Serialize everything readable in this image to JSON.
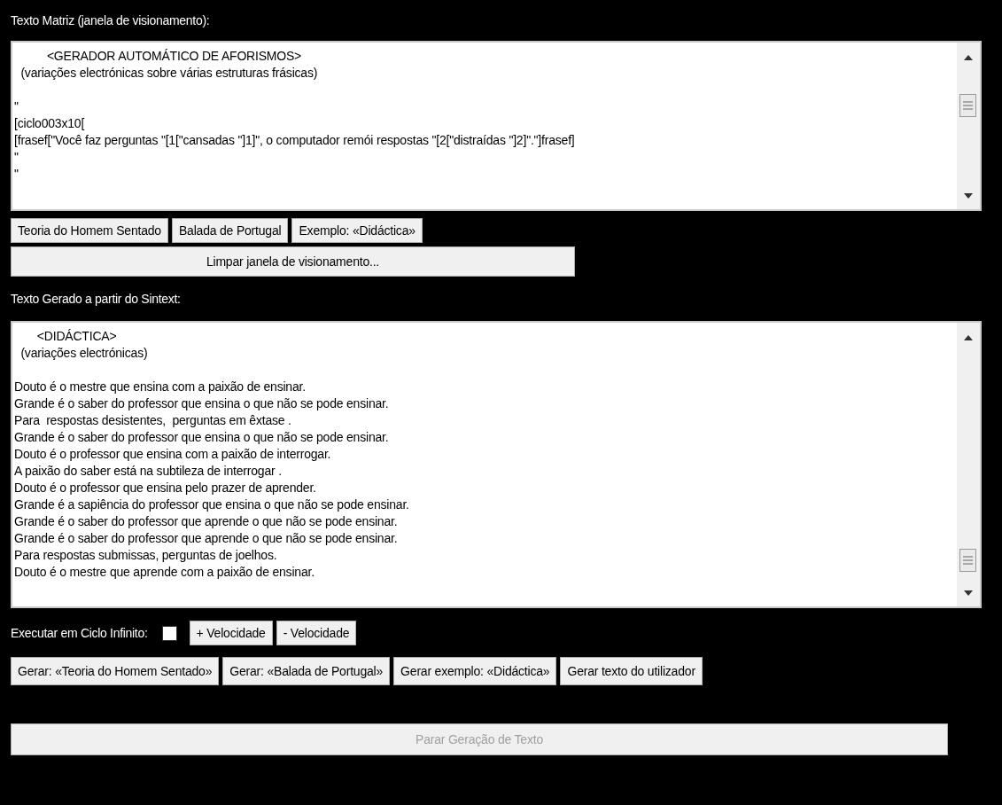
{
  "matrix_label": "Texto Matriz (janela de visionamento):",
  "matrix_text": "          <GERADOR AUTOMÁTICO DE AFORISMOS>\n  (variações electrónicas sobre várias estruturas frásicas)\n\n\"\n[ciclo003x10[\n[frasef[\"Você faz perguntas \"[1[\"cansadas \"]1]\", o computador remói respostas \"[2[\"distraídas \"]2]\".\"]frasef]\n\"\n\"",
  "example_buttons": [
    {
      "label": "Teoria do Homem Sentado"
    },
    {
      "label": "Balada de Portugal"
    },
    {
      "label": "Exemplo: «Didáctica»"
    }
  ],
  "clear_button": "Limpar janela de visionamento...",
  "generated_label": "Texto Gerado a partir do Sintext:",
  "generated_text": "       <DIDÁCTICA>\n  (variações electrónicas)\n\nDouto é o mestre que ensina com a paixão de ensinar.\nGrande é o saber do professor que ensina o que não se pode ensinar.\nPara  respostas desistentes,  perguntas em êxtase .\nGrande é o saber do professor que ensina o que não se pode ensinar.\nDouto é o professor que ensina com a paixão de interrogar.\nA paixão do saber está na subtileza de interrogar .\nDouto é o professor que ensina pelo prazer de aprender.\nGrande é a sapiência do professor que ensina o que não se pode ensinar.\nGrande é o saber do professor que aprende o que não se pode ensinar.\nGrande é o saber do professor que aprende o que não se pode ensinar.\nPara respostas submissas, perguntas de joelhos.\nDouto é o mestre que aprende com a paixão de ensinar.",
  "loop": {
    "label": "Executar em Ciclo Infinito:",
    "checked": false
  },
  "speed_buttons": [
    {
      "label": "+ Velocidade"
    },
    {
      "label": "- Velocidade"
    }
  ],
  "generate_buttons": [
    {
      "label": "Gerar: «Teoria do Homem Sentado»"
    },
    {
      "label": "Gerar: «Balada de Portugal»"
    },
    {
      "label": "Gerar exemplo: «Didáctica»"
    },
    {
      "label": "Gerar texto do utilizador"
    }
  ],
  "stop_button": {
    "label": "Parar Geração de Texto",
    "disabled": true
  }
}
